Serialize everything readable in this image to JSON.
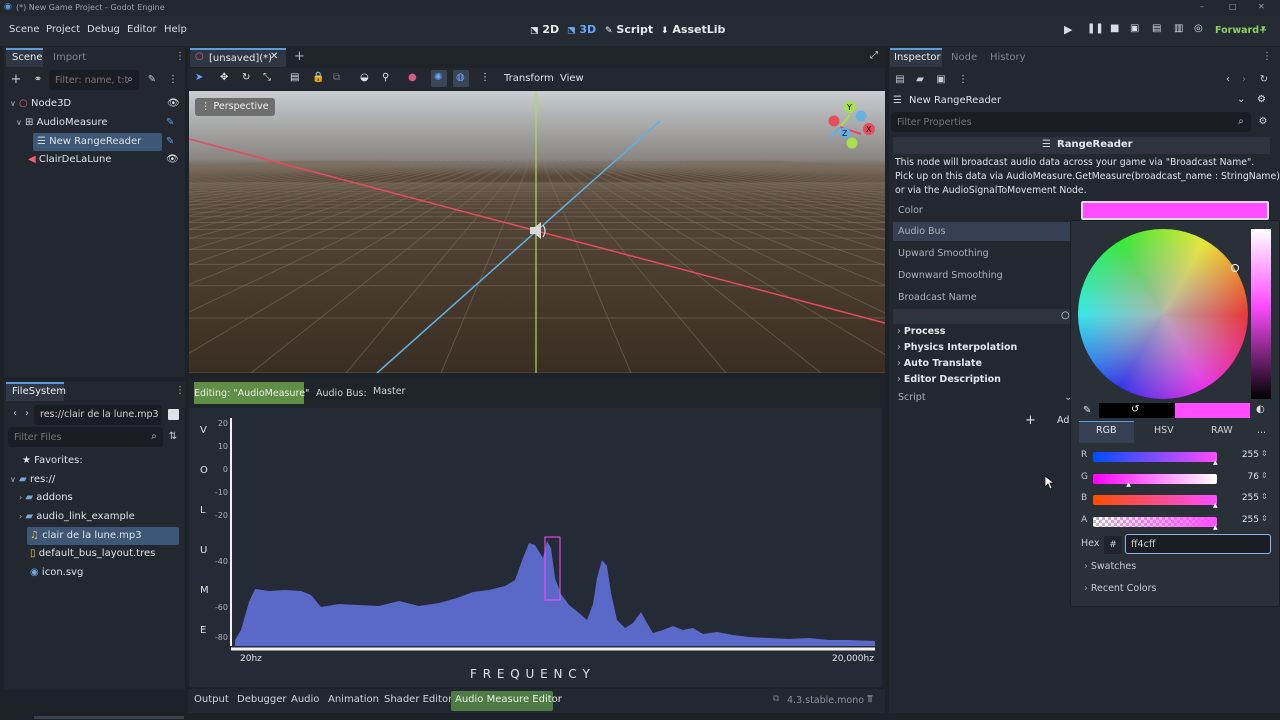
{
  "window": {
    "title": "(*) New Game Project - Godot Engine",
    "controls": [
      "–",
      "□",
      "✕"
    ]
  },
  "menu": [
    "Scene",
    "Project",
    "Debug",
    "Editor",
    "Help"
  ],
  "workspaces": [
    {
      "label": "2D",
      "icon": "⬔"
    },
    {
      "label": "3D",
      "icon": "⬔"
    },
    {
      "label": "Script",
      "icon": "✎"
    },
    {
      "label": "AssetLib",
      "icon": "⬇"
    }
  ],
  "renderer": "Forward+",
  "scene_dock": {
    "tabs": [
      "Scene",
      "Import"
    ],
    "filter_placeholder": "Filter: name, t:t",
    "nodes": [
      {
        "name": "Node3D",
        "icon": "○"
      },
      {
        "name": "AudioMeasure",
        "icon": "⊞"
      },
      {
        "name": "New RangeReader",
        "icon": "☰"
      },
      {
        "name": "ClairDeLaLune",
        "icon": "◀"
      }
    ]
  },
  "filesystem": {
    "title": "FileSystem",
    "path": "res://clair de la lune.mp3",
    "filter_placeholder": "Filter Files",
    "items": [
      {
        "label": "Favorites:",
        "icon": "★"
      },
      {
        "label": "res://",
        "icon": "▰"
      },
      {
        "label": "addons",
        "icon": "▰"
      },
      {
        "label": "audio_link_example",
        "icon": "▰"
      },
      {
        "label": "clair de la lune.mp3",
        "icon": "♫"
      },
      {
        "label": "default_bus_layout.tres",
        "icon": "▯"
      },
      {
        "label": "icon.svg",
        "icon": "◉"
      }
    ]
  },
  "editor_tab": {
    "label": "[unsaved](*)",
    "add": "+"
  },
  "viewport_toolbar": {
    "transform": "Transform",
    "view": "View"
  },
  "viewport": {
    "perspective_label": "Perspective",
    "gizmo": {
      "y": "Y",
      "x": "X",
      "z": "Z"
    }
  },
  "audio_measure": {
    "editing_label": "Editing: \"AudioMeasure\"",
    "bus_label": "Audio Bus:",
    "bus_value": "Master",
    "side_letters": [
      "V",
      "O",
      "L",
      "U",
      "M",
      "E"
    ],
    "y_ticks": [
      "20",
      "10",
      "0",
      "-10",
      "-20",
      "-40",
      "-60",
      "-80"
    ],
    "x_min": "20hz",
    "x_max": "20,000hz",
    "x_title": "F R E Q U E N C Y",
    "fill_color": "#5a68c8",
    "reader_color": "#ff4cff"
  },
  "bottom_panel": {
    "tabs": [
      "Output",
      "Debugger",
      "Audio",
      "Animation",
      "Shader Editor",
      "Audio Measure Editor"
    ],
    "version": "4.3.stable.mono"
  },
  "inspector": {
    "tabs": [
      "Inspector",
      "Node",
      "History"
    ],
    "object_name": "New RangeReader",
    "filter_placeholder": "Filter Properties",
    "class_name": "RangeReader",
    "description": [
      "This node will broadcast audio data across your game via \"Broadcast Name\".",
      "Pick up on this data via AudioMeasure.GetMeasure(broadcast_name : StringName),",
      "or via the AudioSignalToMovement Node."
    ],
    "properties": [
      "Color",
      "Audio Bus",
      "Upward Smoothing",
      "Downward Smoothing",
      "Broadcast Name"
    ],
    "sections": [
      "Process",
      "Physics Interpolation",
      "Auto Translate",
      "Editor Description"
    ],
    "script_label": "Script",
    "add_label": "Ad",
    "color_value": "#ff4cff"
  },
  "color_picker": {
    "modes": [
      "RGB",
      "HSV",
      "RAW"
    ],
    "more": "...",
    "channels": [
      {
        "label": "R",
        "value": "255",
        "level": 1.0
      },
      {
        "label": "G",
        "value": "76",
        "level": 0.3
      },
      {
        "label": "B",
        "value": "255",
        "level": 1.0
      },
      {
        "label": "A",
        "value": "255",
        "level": 1.0
      }
    ],
    "hex_label": "Hex",
    "hash": "#",
    "hex_value": "ff4cff",
    "swatches_label": "Swatches",
    "recent_label": "Recent Colors"
  }
}
